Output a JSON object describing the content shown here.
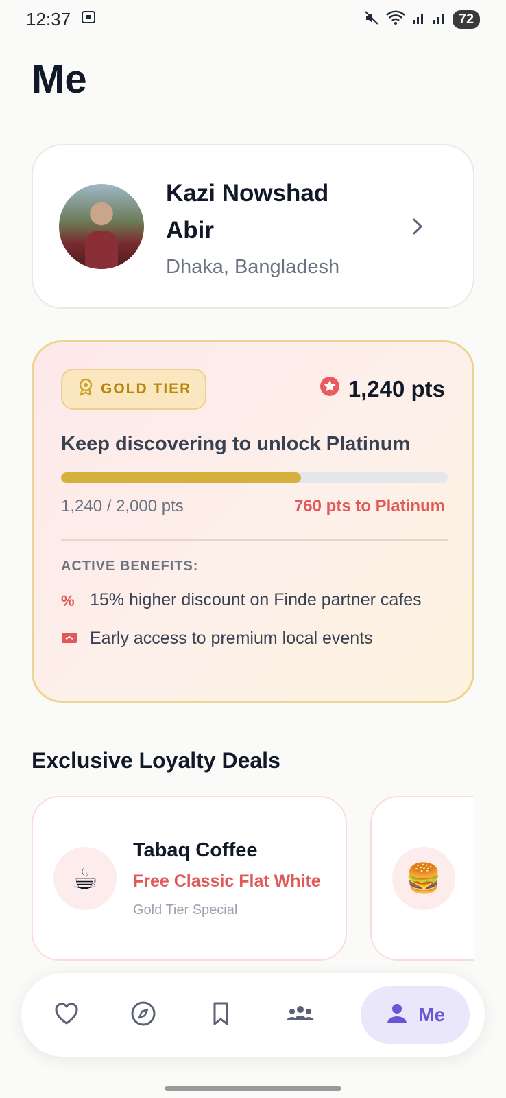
{
  "status_bar": {
    "time": "12:37",
    "battery": "72"
  },
  "page": {
    "title": "Me"
  },
  "profile": {
    "name": "Kazi Nowshad Abir",
    "location": "Dhaka, Bangladesh"
  },
  "tier": {
    "badge": "GOLD TIER",
    "points": "1,240 pts",
    "headline": "Keep discovering to unlock Platinum",
    "progress_fraction": 0.62,
    "progress_current": "1,240 / 2,000 pts",
    "progress_remaining": "760 pts to Platinum",
    "benefits_title": "ACTIVE BENEFITS:",
    "benefits": [
      {
        "icon": "percent-icon",
        "text": "15% higher discount on Finde partner cafes"
      },
      {
        "icon": "ticket-icon",
        "text": "Early access to premium local events"
      }
    ]
  },
  "deals": {
    "title": "Exclusive Loyalty Deals",
    "items": [
      {
        "emoji": "☕",
        "name": "Tabaq Coffee",
        "offer": "Free Classic Flat White",
        "tag": "Gold Tier Special"
      },
      {
        "emoji": "🍔",
        "name": "",
        "offer": "",
        "tag": ""
      }
    ]
  },
  "nav": {
    "items": [
      "heart-icon",
      "compass-icon",
      "bookmark-icon",
      "people-icon"
    ],
    "active_label": "Me"
  },
  "colors": {
    "accent": "#6a55d6",
    "gold": "#d4b03c",
    "coral": "#e05a5a"
  }
}
